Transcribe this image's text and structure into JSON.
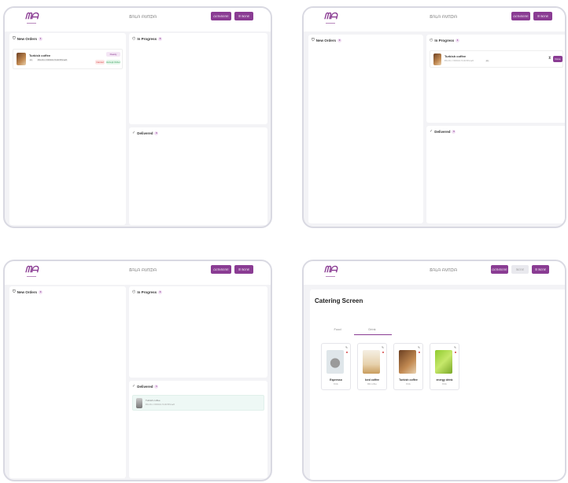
{
  "app": {
    "logo": "ᗰᗩ",
    "top_title": "ᘔᗩᒪᗩ ᗩᐯᗰᗪᗩ"
  },
  "buttons": {
    "primary": "ᗩᕮᗰ ᗰᕮᑎᗴ",
    "secondary": "☰ ᗰᕮᑎᗴ",
    "light": "ᗰᕮᑎᗴ",
    "catering_primary": "ᗩᕮᗰ ᗰᕮᑎᗴ"
  },
  "sections": {
    "new_orders": "New Orders",
    "in_progress": "In Progress",
    "delivered": "Delivered"
  },
  "counts": {
    "new_orders": "1",
    "in_progress": "0",
    "delivered": "0",
    "new_orders_2": "0",
    "in_progress_2": "1",
    "delivered_2": "0",
    "new_orders_3": "0",
    "in_progress_3": "0",
    "delivered_3": "1"
  },
  "order": {
    "name": "Turkish coffee",
    "qty_tag": "x1",
    "note": "ᗰᕮᒪᗩᑎ ᑕOᖴᖴᕮᕮ ᗩᑎᗪ ᗰᗩᑕᕼᗩ",
    "cancel": "Cancel",
    "accept": "Accept Order",
    "ready": "Ready",
    "done": "Done"
  },
  "catering": {
    "title": "Catering Screen",
    "tabs": [
      "Food",
      "Drink"
    ],
    "products": [
      {
        "name": "Espresso",
        "cat": "Drink",
        "color": "#dfe6ea"
      },
      {
        "name": "Iced coffee",
        "cat": "Milk coffee",
        "color": "#e7d2ad"
      },
      {
        "name": "Turkish coffee",
        "cat": "Drink",
        "color": "#7a4a2a"
      },
      {
        "name": "energy drink",
        "cat": "Drink",
        "color": "#a7d64a"
      }
    ]
  },
  "colors": {
    "accent": "#8a3c93",
    "bg": "#f3f3f6"
  }
}
